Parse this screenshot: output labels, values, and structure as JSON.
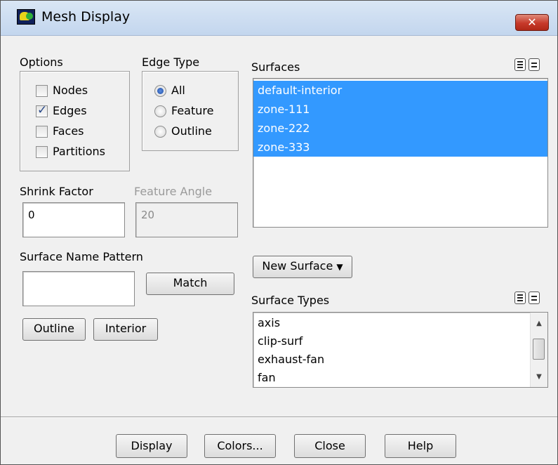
{
  "window": {
    "title": "Mesh Display",
    "close_label": "✕"
  },
  "options": {
    "label": "Options",
    "items": [
      {
        "label": "Nodes",
        "checked": false
      },
      {
        "label": "Edges",
        "checked": true
      },
      {
        "label": "Faces",
        "checked": false
      },
      {
        "label": "Partitions",
        "checked": false
      }
    ]
  },
  "edge_type": {
    "label": "Edge Type",
    "items": [
      {
        "label": "All",
        "selected": true
      },
      {
        "label": "Feature",
        "selected": false
      },
      {
        "label": "Outline",
        "selected": false
      }
    ]
  },
  "shrink_factor": {
    "label": "Shrink Factor",
    "value": "0"
  },
  "feature_angle": {
    "label": "Feature Angle",
    "value": "20"
  },
  "surface_name_pattern": {
    "label": "Surface Name Pattern",
    "value": "",
    "match_label": "Match"
  },
  "outline_button": "Outline",
  "interior_button": "Interior",
  "surfaces": {
    "label": "Surfaces",
    "items": [
      {
        "label": "default-interior",
        "selected": true
      },
      {
        "label": "zone-111",
        "selected": true
      },
      {
        "label": "zone-222",
        "selected": true
      },
      {
        "label": "zone-333",
        "selected": true
      }
    ]
  },
  "new_surface": {
    "label": "New Surface",
    "arrow": "▼"
  },
  "surface_types": {
    "label": "Surface Types",
    "items": [
      "axis",
      "clip-surf",
      "exhaust-fan",
      "fan"
    ]
  },
  "bottom_buttons": {
    "display": "Display",
    "colors": "Colors...",
    "close": "Close",
    "help": "Help"
  },
  "icons": {
    "select_all": "select-all-icon",
    "deselect_all": "deselect-all-icon"
  }
}
